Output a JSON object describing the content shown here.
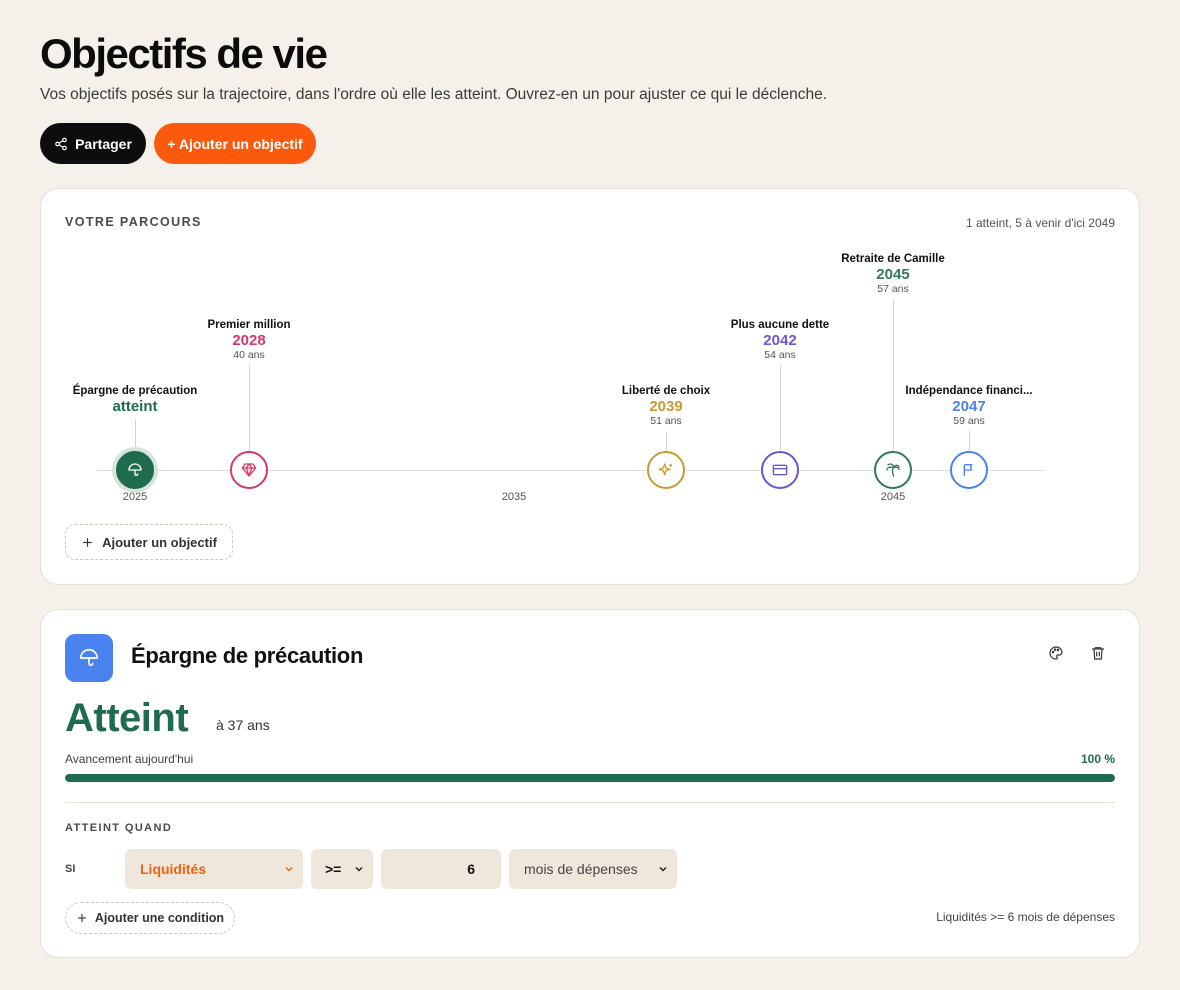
{
  "page": {
    "title": "Objectifs de vie",
    "subtitle": "Vos objectifs posés sur la trajectoire, dans l'ordre où elle les atteint. Ouvrez-en un pour ajuster ce qui le déclenche."
  },
  "actions": {
    "share_label": "Partager",
    "add_goal_label": "+ Ajouter un objectif"
  },
  "journey": {
    "section_label": "VOTRE PARCOURS",
    "summary": "1 atteint, 5 à venir d'ici 2049",
    "axis_ticks": [
      "2025",
      "2035",
      "2045"
    ],
    "goals": [
      {
        "name": "Épargne de précaution",
        "year": "atteint",
        "age": "",
        "icon": "umbrella-icon",
        "color": "#1e6b4d",
        "achieved": true
      },
      {
        "name": "Premier million",
        "year": "2028",
        "age": "40 ans",
        "icon": "diamond-icon",
        "color": "#d33a6a",
        "achieved": false
      },
      {
        "name": "Liberté de choix",
        "year": "2039",
        "age": "51 ans",
        "icon": "sparkles-icon",
        "color": "#c99a33",
        "achieved": false
      },
      {
        "name": "Plus aucune dette",
        "year": "2042",
        "age": "54 ans",
        "icon": "credit-card-icon",
        "color": "#6a56d6",
        "achieved": false
      },
      {
        "name": "Retraite de Camille",
        "year": "2045",
        "age": "57 ans",
        "icon": "palm-tree-icon",
        "color": "#2f7a5a",
        "achieved": false
      },
      {
        "name": "Indépendance financi...",
        "year": "2047",
        "age": "59 ans",
        "icon": "flag-icon",
        "color": "#4a82f0",
        "achieved": false
      }
    ],
    "add_goal_label": "Ajouter un objectif"
  },
  "detail": {
    "title": "Épargne de précaution",
    "icon": "umbrella-icon",
    "icon_bg": "#4a82f0",
    "status": "Atteint",
    "status_age": "à 37 ans",
    "progress_label": "Avancement aujourd'hui",
    "progress_pct": "100 %",
    "progress_value": 1.0,
    "condition_section": "ATTEINT QUAND",
    "condition_prefix": "SI",
    "metric": "Liquidités",
    "operator": ">=",
    "value": "6",
    "unit": "mois de dépenses",
    "add_condition_label": "Ajouter une condition",
    "condition_summary": "Liquidités >= 6 mois de dépenses"
  },
  "colors": {
    "accent": "#fb5a0c",
    "success": "#1e6b4d",
    "background": "#f5f0ea"
  }
}
